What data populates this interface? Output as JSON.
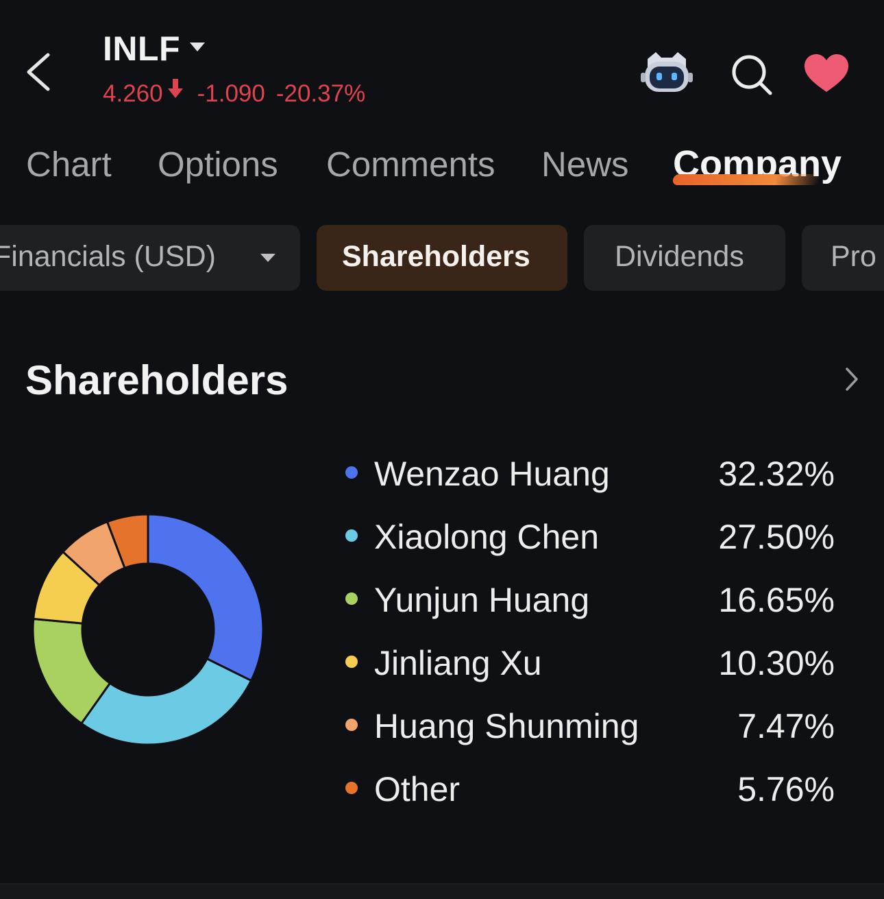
{
  "header": {
    "ticker": "INLF",
    "price": "4.260",
    "change": "-1.090",
    "change_pct": "-20.37%",
    "colors": {
      "down": "#e0434f"
    }
  },
  "tabs": [
    {
      "label": "Chart",
      "active": false
    },
    {
      "label": "Options",
      "active": false
    },
    {
      "label": "Comments",
      "active": false
    },
    {
      "label": "News",
      "active": false
    },
    {
      "label": "Company",
      "active": true
    }
  ],
  "subtabs": [
    {
      "label": "Financials (USD)",
      "active": false
    },
    {
      "label": "Shareholders",
      "active": true
    },
    {
      "label": "Dividends",
      "active": false
    },
    {
      "label": "Pro",
      "active": false
    }
  ],
  "section": {
    "title": "Shareholders"
  },
  "chart_data": {
    "type": "pie",
    "categories": [
      "Wenzao Huang",
      "Xiaolong Chen",
      "Yunjun Huang",
      "Jinliang Xu",
      "Huang Shunming",
      "Other"
    ],
    "values": [
      32.32,
      27.5,
      16.65,
      10.3,
      7.47,
      5.76
    ],
    "labels": [
      "32.32%",
      "27.50%",
      "16.65%",
      "10.30%",
      "7.47%",
      "5.76%"
    ],
    "colors": [
      "#4f73ef",
      "#6bcbe5",
      "#a8d15f",
      "#f5cd4f",
      "#f1a46c",
      "#e5732c"
    ]
  }
}
